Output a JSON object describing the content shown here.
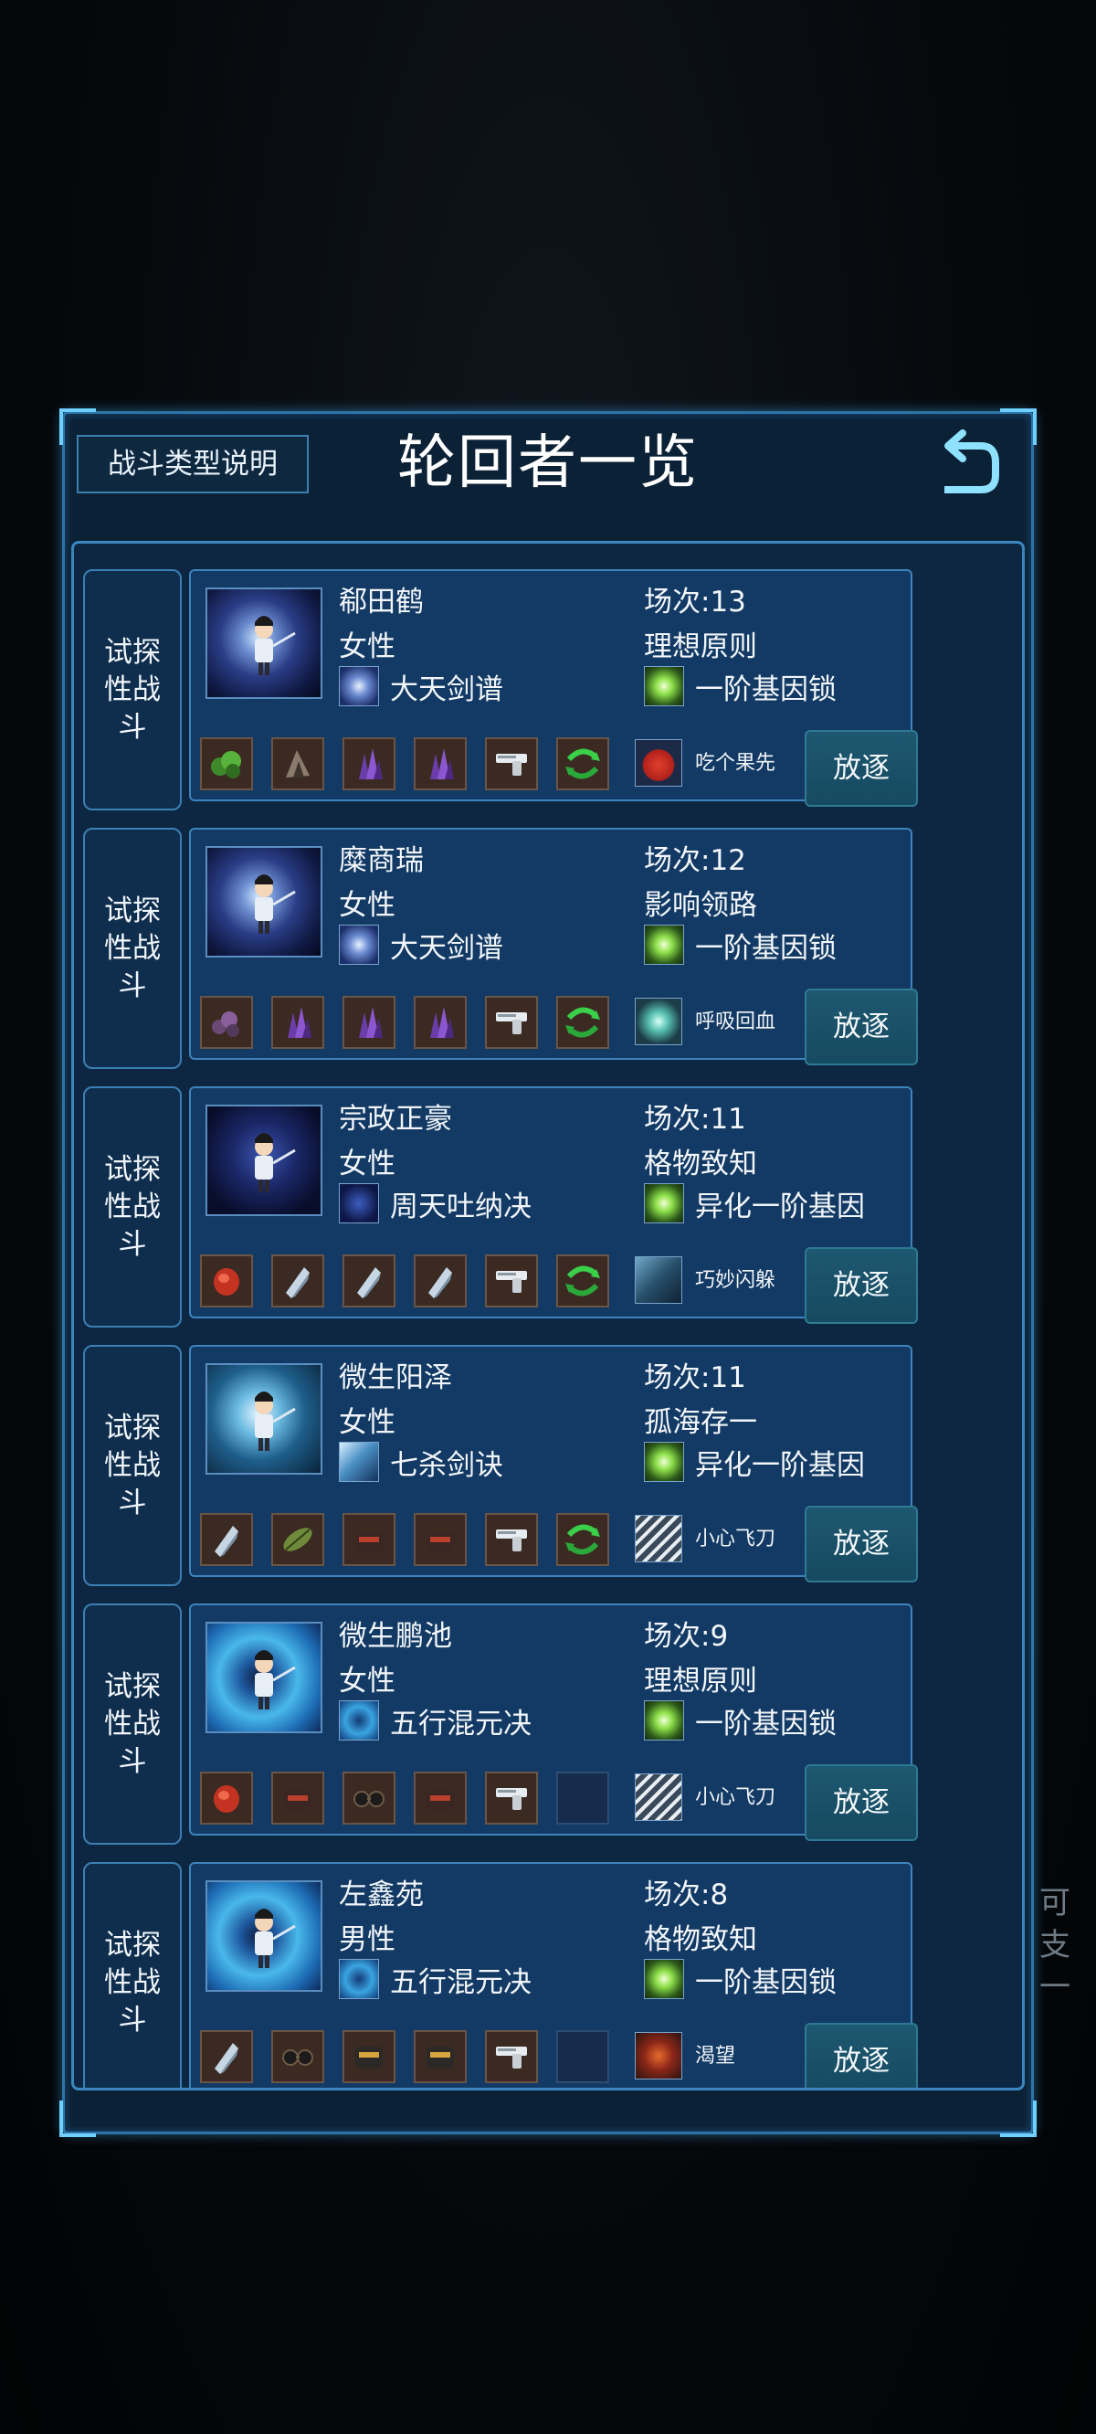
{
  "header": {
    "type_button": "战斗类型说明",
    "title": "轮回者一览"
  },
  "background_text": [
    "可",
    "支",
    "一"
  ],
  "rows": [
    {
      "tag": "试探性战斗",
      "name": "郗田鹤",
      "gender": "女性",
      "skill": "大天剑谱",
      "field": "场次:13",
      "attribute": "理想原则",
      "gene": "一阶基因锁",
      "trait": "吃个果先",
      "exile": "放逐",
      "items": [
        "green-ore",
        "rock-shard",
        "purple-crystal",
        "purple-crystal",
        "pistol",
        "green-swirl"
      ],
      "trait_icon": "red-apple"
    },
    {
      "tag": "试探性战斗",
      "name": "糜商瑞",
      "gender": "女性",
      "skill": "大天剑谱",
      "field": "场次:12",
      "attribute": "影响领路",
      "gene": "一阶基因锁",
      "trait": "呼吸回血",
      "exile": "放逐",
      "items": [
        "purple-ore",
        "purple-crystal",
        "purple-crystal",
        "purple-crystal",
        "pistol",
        "green-swirl"
      ],
      "trait_icon": "lightning-breath"
    },
    {
      "tag": "试探性战斗",
      "name": "宗政正豪",
      "gender": "女性",
      "skill": "周天吐纳决",
      "field": "场次:11",
      "attribute": "格物致知",
      "gene": "异化一阶基因",
      "trait": "巧妙闪躲",
      "exile": "放逐",
      "items": [
        "red-glove",
        "silver-crystal",
        "silver-crystal",
        "silver-crystal",
        "pistol",
        "green-swirl"
      ],
      "trait_icon": "dodge-wolf"
    },
    {
      "tag": "试探性战斗",
      "name": "微生阳泽",
      "gender": "女性",
      "skill": "七杀剑诀",
      "field": "场次:11",
      "attribute": "孤海存一",
      "gene": "异化一阶基因",
      "trait": "小心飞刀",
      "exile": "放逐",
      "items": [
        "silver-crystal",
        "green-leaf",
        "dark-helmet",
        "dark-helmet",
        "pistol",
        "green-swirl"
      ],
      "trait_icon": "flying-knives"
    },
    {
      "tag": "试探性战斗",
      "name": "微生鹏池",
      "gender": "女性",
      "skill": "五行混元决",
      "field": "场次:9",
      "attribute": "理想原则",
      "gene": "一阶基因锁",
      "trait": "小心飞刀",
      "exile": "放逐",
      "items": [
        "red-glove",
        "dark-helmet",
        "goggles",
        "dark-helmet",
        "pistol",
        "empty"
      ],
      "trait_icon": "flying-knives"
    },
    {
      "tag": "试探性战斗",
      "name": "左鑫苑",
      "gender": "男性",
      "skill": "五行混元决",
      "field": "场次:8",
      "attribute": "格物致知",
      "gene": "一阶基因锁",
      "trait": "渴望",
      "exile": "放逐",
      "items": [
        "silver-crystal",
        "goggles",
        "gold-helmet",
        "gold-helmet",
        "pistol",
        "empty"
      ],
      "trait_icon": "red-beast"
    }
  ],
  "portraits": [
    "swirl-swordsman",
    "swirl-swordsman",
    "constellation-warrior",
    "ice-swordsman",
    "water-vortex-mage",
    "water-vortex-mage"
  ],
  "skill_icons": [
    "sword-swirl",
    "sword-swirl",
    "constellation",
    "ice-blades",
    "water-swirl",
    "water-swirl"
  ],
  "colors": {
    "panel": "#0b2136",
    "card": "#133a64",
    "border": "#3d84bd",
    "exile_button": "#1d5870"
  }
}
